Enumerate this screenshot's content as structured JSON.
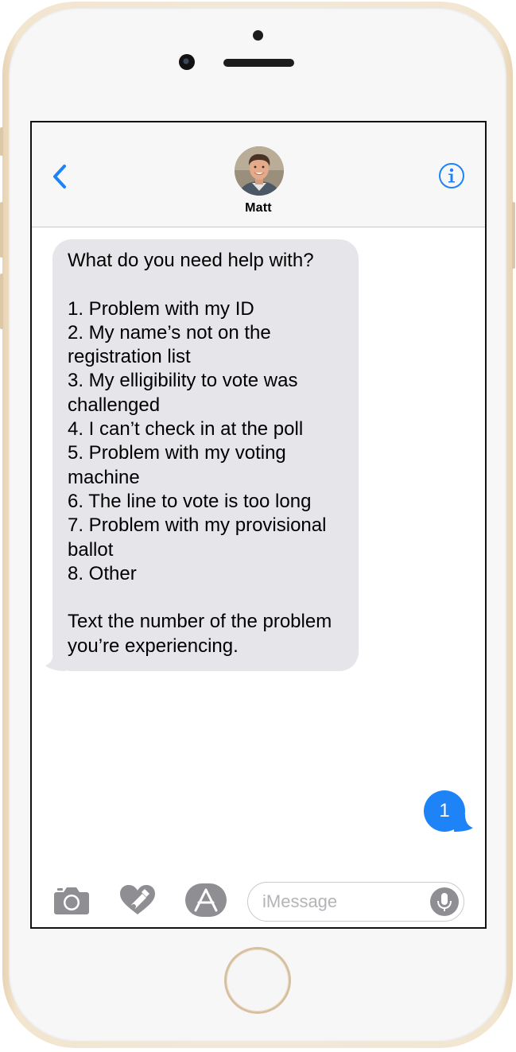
{
  "contact": {
    "name": "Matt"
  },
  "messages": {
    "incoming_lines": [
      "What do you need help with?",
      "",
      "1. Problem with my ID",
      "2. My name’s not on the",
      "registration list",
      "3. My elligibility to vote was",
      "challenged",
      "4. I can’t check in at the poll",
      "5. Problem with my voting",
      "machine",
      "6. The line to vote is too long",
      "7. Problem with my provisional",
      "ballot",
      "8. Other",
      "",
      "Text the number of the problem",
      "you’re experiencing."
    ],
    "outgoing_text": "1"
  },
  "input_bar": {
    "placeholder": "iMessage"
  },
  "icons": {
    "back": "chevron-left-icon",
    "info": "info-icon",
    "camera": "camera-icon",
    "digital_touch": "heart-touch-icon",
    "app_store": "app-store-icon",
    "mic": "microphone-icon"
  },
  "colors": {
    "accent": "#1e83f7",
    "incoming_bubble": "#e5e5ea",
    "icon_gray": "#8e8e93"
  }
}
